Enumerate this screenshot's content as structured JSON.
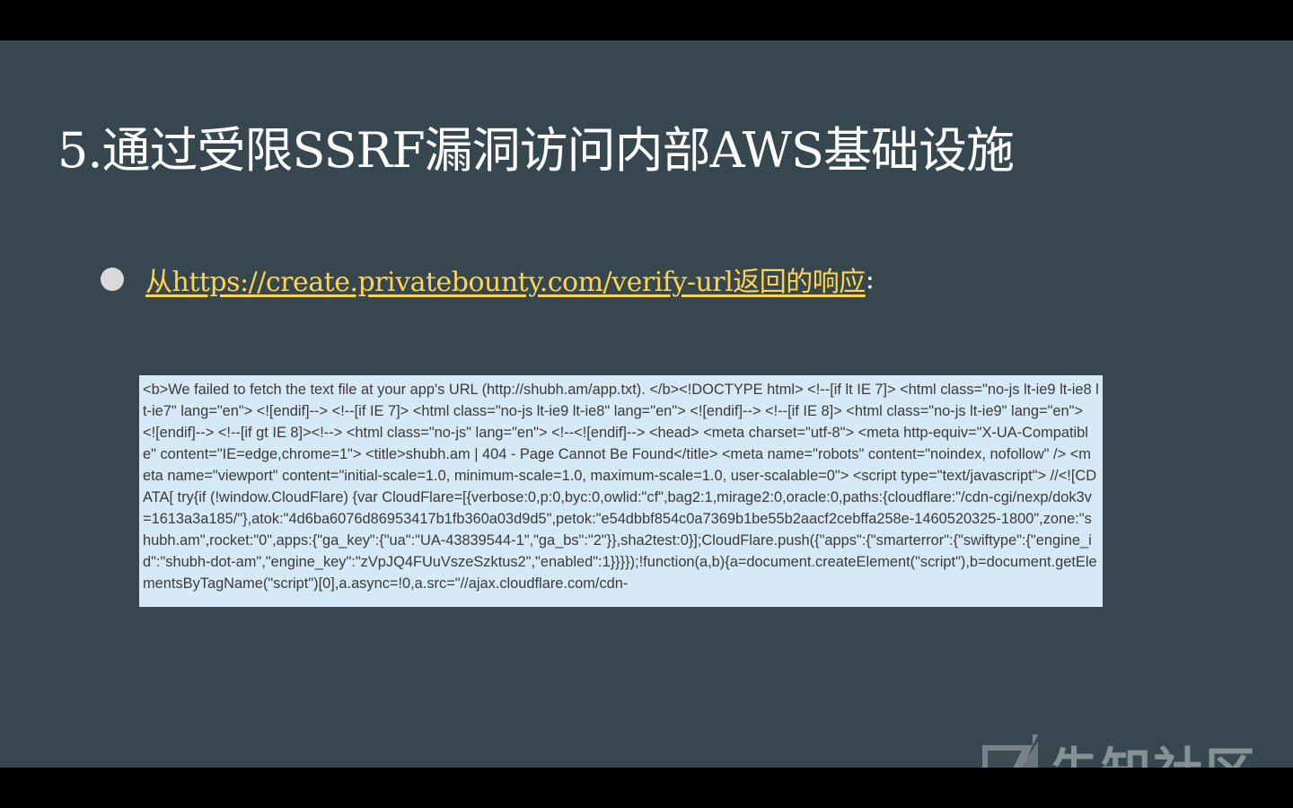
{
  "slide": {
    "title": "5.通过受限SSRF漏洞访问内部AWS基础设施",
    "bullet": {
      "link_text": "从https://create.privatebounty.com/verify-url返回的响应",
      "suffix": ":"
    },
    "code_excerpt": "<b>We failed to fetch the text file at your app's URL (http://shubh.am/app.txt). </b><!DOCTYPE html> <!--[if lt IE 7]> <html class=\"no-js lt-ie9 lt-ie8 lt-ie7\" lang=\"en\"> <![endif]--> <!--[if IE 7]> <html class=\"no-js lt-ie9 lt-ie8\" lang=\"en\"> <![endif]--> <!--[if IE 8]> <html class=\"no-js lt-ie9\" lang=\"en\"> <![endif]--> <!--[if gt IE 8]><!--> <html class=\"no-js\" lang=\"en\"> <!--<![endif]--> <head> <meta charset=\"utf-8\"> <meta http-equiv=\"X-UA-Compatible\" content=\"IE=edge,chrome=1\"> <title>shubh.am | 404 - Page Cannot Be Found</title> <meta name=\"robots\" content=\"noindex, nofollow\" /> <meta name=\"viewport\" content=\"initial-scale=1.0, minimum-scale=1.0, maximum-scale=1.0, user-scalable=0\"> <script type=\"text/javascript\"> //<![CDATA[ try{if (!window.CloudFlare) {var CloudFlare=[{verbose:0,p:0,byc:0,owlid:\"cf\",bag2:1,mirage2:0,oracle:0,paths:{cloudflare:\"/cdn-cgi/nexp/dok3v=1613a3a185/\"},atok:\"4d6ba6076d86953417b1fb360a03d9d5\",petok:\"e54dbbf854c0a7369b1be55b2aacf2cebffa258e-1460520325-1800\",zone:\"shubh.am\",rocket:\"0\",apps:{\"ga_key\":{\"ua\":\"UA-43839544-1\",\"ga_bs\":\"2\"}},sha2test:0}];CloudFlare.push({\"apps\":{\"smarterror\":{\"swiftype\":{\"engine_id\":\"shubh-dot-am\",\"engine_key\":\"zVpJQ4FUuVszeSzktus2\",\"enabled\":1}}}});!function(a,b){a=document.createElement(\"script\"),b=document.getElementsByTagName(\"script\")[0],a.async=!0,a.src=\"//ajax.cloudflare.com/cdn-"
  },
  "watermark": {
    "text": "先知社区",
    "icon": "xianzhi-logo-icon"
  },
  "colors": {
    "slide_bg": "#37474f",
    "link": "#ffd54f",
    "code_bg": "#d5eaf6"
  }
}
